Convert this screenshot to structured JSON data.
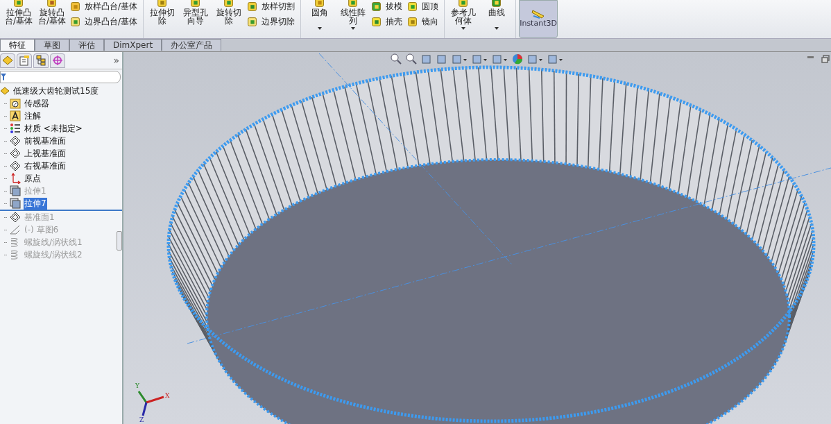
{
  "ribbon": {
    "groups": [
      {
        "large": [
          {
            "label": "拉伸凸台/基体",
            "dropdown": false
          },
          {
            "label": "旋转凸台/基体",
            "dropdown": false
          }
        ],
        "small": [
          [
            {
              "label": "放样凸台/基体"
            },
            {
              "label": "边界凸台/基体"
            }
          ]
        ]
      },
      {
        "large": [
          {
            "label": "拉伸切除",
            "dropdown": false
          },
          {
            "label": "异型孔向导",
            "dropdown": false
          },
          {
            "label": "旋转切除",
            "dropdown": false
          }
        ],
        "small": [
          [
            {
              "label": "放样切割"
            },
            {
              "label": "边界切除"
            }
          ]
        ]
      },
      {
        "large": [
          {
            "label": "圆角",
            "dropdown": true
          },
          {
            "label": "线性阵列",
            "dropdown": true
          }
        ],
        "small": [
          [
            {
              "label": "拔模"
            },
            {
              "label": "抽壳"
            }
          ],
          [
            {
              "label": "圆顶"
            },
            {
              "label": "镜向"
            }
          ]
        ]
      },
      {
        "large": [
          {
            "label": "参考几何体",
            "dropdown": true
          },
          {
            "label": "曲线",
            "dropdown": true
          }
        ]
      }
    ],
    "instant3d": {
      "label": "Instant3D",
      "selected": true
    }
  },
  "tabs": [
    {
      "label": "特征",
      "selected": true
    },
    {
      "label": "草图",
      "selected": false
    },
    {
      "label": "评估",
      "selected": false
    },
    {
      "label": "DimXpert",
      "selected": false
    },
    {
      "label": "办公室产品",
      "selected": false
    }
  ],
  "panel": {
    "more": "»",
    "tree": {
      "label": "低速级大齿轮测试15度",
      "kind": "part",
      "selected": false,
      "dimmed": false,
      "children": [
        {
          "label": "传感器",
          "kind": "sensor",
          "selected": false,
          "dimmed": false
        },
        {
          "label": "注解",
          "kind": "annotation",
          "selected": false,
          "dimmed": false
        },
        {
          "label": "材质 <未指定>",
          "kind": "material",
          "selected": false,
          "dimmed": false
        },
        {
          "label": "前视基准面",
          "kind": "plane",
          "selected": false,
          "dimmed": false
        },
        {
          "label": "上视基准面",
          "kind": "plane",
          "selected": false,
          "dimmed": false
        },
        {
          "label": "右视基准面",
          "kind": "plane",
          "selected": false,
          "dimmed": false
        },
        {
          "label": "原点",
          "kind": "origin",
          "selected": false,
          "dimmed": false
        },
        {
          "label": "拉伸1",
          "kind": "extrude",
          "selected": false,
          "dimmed": true
        },
        {
          "label": "拉伸7",
          "kind": "extrude",
          "selected": true,
          "dimmed": false
        },
        {
          "kind": "rollback"
        },
        {
          "label": "基准面1",
          "kind": "plane",
          "selected": false,
          "dimmed": true
        },
        {
          "label": "(-) 草图6",
          "kind": "sketch",
          "selected": false,
          "dimmed": true
        },
        {
          "label": "螺旋线/涡状线1",
          "kind": "helix",
          "selected": false,
          "dimmed": true
        },
        {
          "label": "螺旋线/涡状线2",
          "kind": "helix",
          "selected": false,
          "dimmed": true
        }
      ]
    }
  },
  "viewport": {
    "triad": {
      "x": "X",
      "y": "Y",
      "z": "Z"
    }
  }
}
